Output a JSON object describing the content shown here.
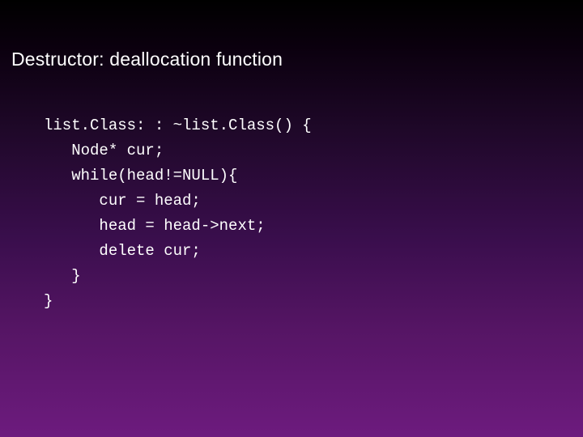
{
  "title": "Destructor: deallocation function",
  "code": {
    "l0": "list.Class: : ~list.Class() {",
    "l1": "   Node* cur;",
    "l2": "   while(head!=NULL){",
    "l3": "      cur = head;",
    "l4": "      head = head->next;",
    "l5": "      delete cur;",
    "l6": "   }",
    "l7": "}"
  }
}
